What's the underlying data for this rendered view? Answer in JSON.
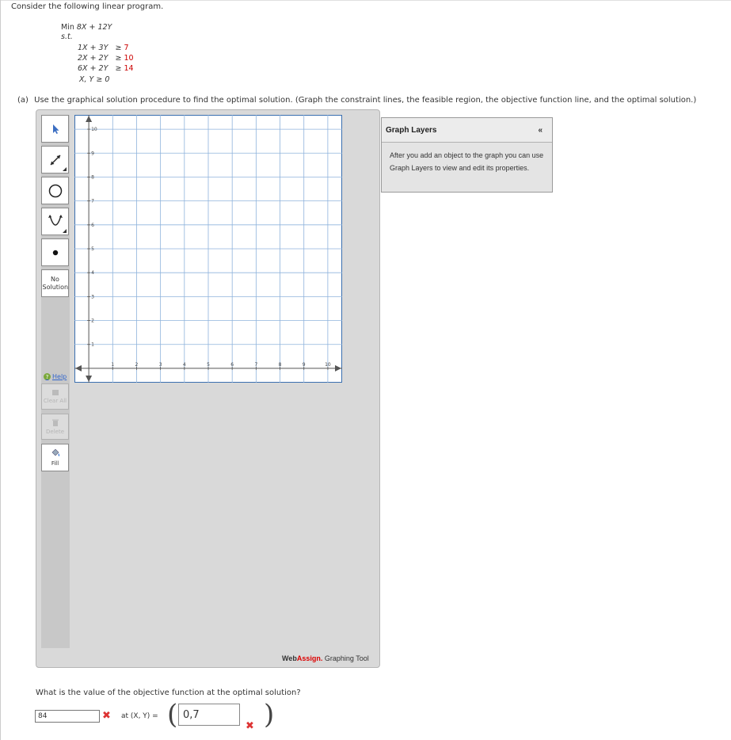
{
  "intro": "Consider the following linear program.",
  "lp": {
    "objective": {
      "prefix": "Min ",
      "expr": "8X + 12Y"
    },
    "st": "s.t.",
    "constraints": [
      {
        "lhs": "1X + 3Y",
        "op": "≥",
        "rhs": "7"
      },
      {
        "lhs": "2X + 2Y",
        "op": "≥",
        "rhs": "10"
      },
      {
        "lhs": "6X + 2Y",
        "op": "≥",
        "rhs": "14"
      }
    ],
    "nonneg": "X, Y ≥ 0"
  },
  "part_a": {
    "label": "(a)",
    "text": "Use the graphical solution procedure to find the optimal solution. (Graph the constraint lines, the feasible region, the objective function line, and the optimal solution.)"
  },
  "toolbar": {
    "no_solution": "No Solution",
    "help": "Help",
    "clear_all": "Clear All",
    "delete": "Delete",
    "fill": "Fill"
  },
  "graph": {
    "x_ticks": [
      "1",
      "2",
      "3",
      "4",
      "5",
      "6",
      "7",
      "8",
      "9",
      "10"
    ],
    "y_ticks": [
      "1",
      "2",
      "3",
      "4",
      "5",
      "6",
      "7",
      "8",
      "9",
      "10"
    ],
    "x_min": -0.6,
    "x_max": 10.6,
    "y_min": -0.6,
    "y_max": 10.6,
    "grid_color": "#8fb3dc"
  },
  "branding": {
    "web": "Web",
    "assign": "Assign.",
    "tool": " Graphing Tool"
  },
  "layers": {
    "title": "Graph Layers",
    "collapse": "«",
    "body": "After you add an object to the graph you can use Graph Layers to view and edit its properties."
  },
  "question": {
    "text": "What is the value of the objective function at the optimal solution?",
    "value": "84",
    "at_label": "at (X, Y) =",
    "pair_value": "0,7",
    "wrong_mark": "✖"
  }
}
